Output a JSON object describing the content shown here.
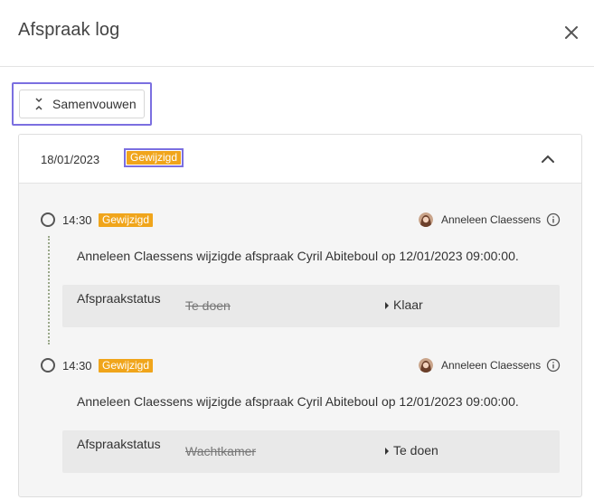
{
  "dialog": {
    "title": "Afspraak log"
  },
  "toolbar": {
    "collapse_label": "Samenvouwen"
  },
  "group": {
    "date": "18/01/2023",
    "badge": "Gewijzigd"
  },
  "entries": [
    {
      "time": "14:30",
      "badge": "Gewijzigd",
      "user": "Anneleen Claessens",
      "description": "Anneleen Claessens wijzigde afspraak Cyril Abiteboul op 12/01/2023 09:00:00.",
      "field": "Afspraakstatus",
      "old_value": "Te doen",
      "new_value": "Klaar"
    },
    {
      "time": "14:30",
      "badge": "Gewijzigd",
      "user": "Anneleen Claessens",
      "description": "Anneleen Claessens wijzigde afspraak Cyril Abiteboul op 12/01/2023 09:00:00.",
      "field": "Afspraakstatus",
      "old_value": "Wachtkamer",
      "new_value": "Te doen"
    }
  ],
  "colors": {
    "badge": "#f0a51b",
    "highlight_outline": "#7b6fe0"
  },
  "icons": {
    "close": "close-icon",
    "collapse": "collapse-all-icon",
    "chevron": "chevron-up-icon",
    "info": "info-icon",
    "timeline": "timeline-circle-icon",
    "state_change": "caret-right-icon"
  }
}
